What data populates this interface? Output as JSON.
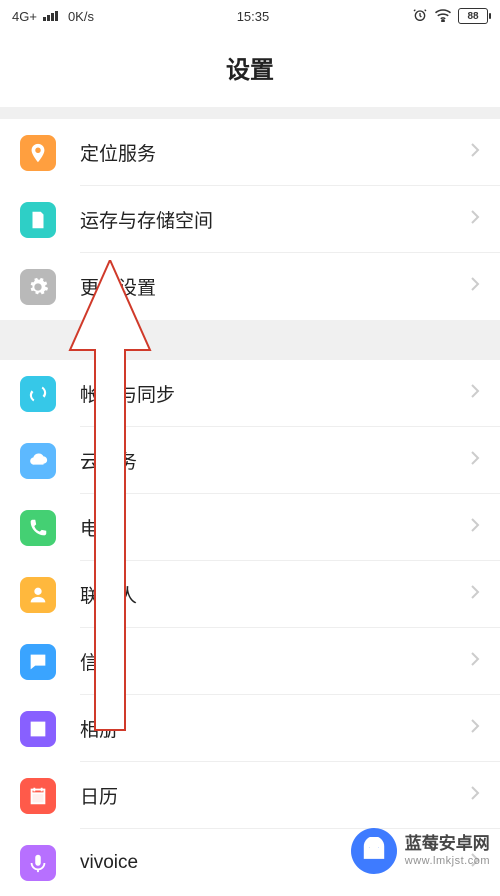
{
  "status": {
    "network": "4G+",
    "speed": "0K/s",
    "time": "15:35",
    "battery": "88"
  },
  "header": {
    "title": "设置"
  },
  "groups": [
    {
      "items": [
        {
          "label": "定位服务",
          "icon": "location-icon",
          "bg": "bg-orange"
        },
        {
          "label": "运存与存储空间",
          "icon": "storage-icon",
          "bg": "bg-teal"
        },
        {
          "label": "更多设置",
          "icon": "gear-icon",
          "bg": "bg-gray"
        }
      ]
    },
    {
      "items": [
        {
          "label": "帐号与同步",
          "icon": "sync-icon",
          "bg": "bg-cyan"
        },
        {
          "label": "云服务",
          "icon": "cloud-icon",
          "bg": "bg-skyblue"
        },
        {
          "label": "电话",
          "icon": "phone-icon",
          "bg": "bg-green"
        },
        {
          "label": "联系人",
          "icon": "contact-icon",
          "bg": "bg-amber"
        },
        {
          "label": "信息",
          "icon": "message-icon",
          "bg": "bg-blue"
        },
        {
          "label": "相册",
          "icon": "gallery-icon",
          "bg": "bg-purple"
        },
        {
          "label": "日历",
          "icon": "calendar-icon",
          "bg": "bg-red"
        },
        {
          "label": "vivoice",
          "icon": "voice-icon",
          "bg": "bg-violet"
        }
      ]
    }
  ],
  "watermark": {
    "title": "蓝莓安卓网",
    "url": "www.lmkjst.com"
  }
}
